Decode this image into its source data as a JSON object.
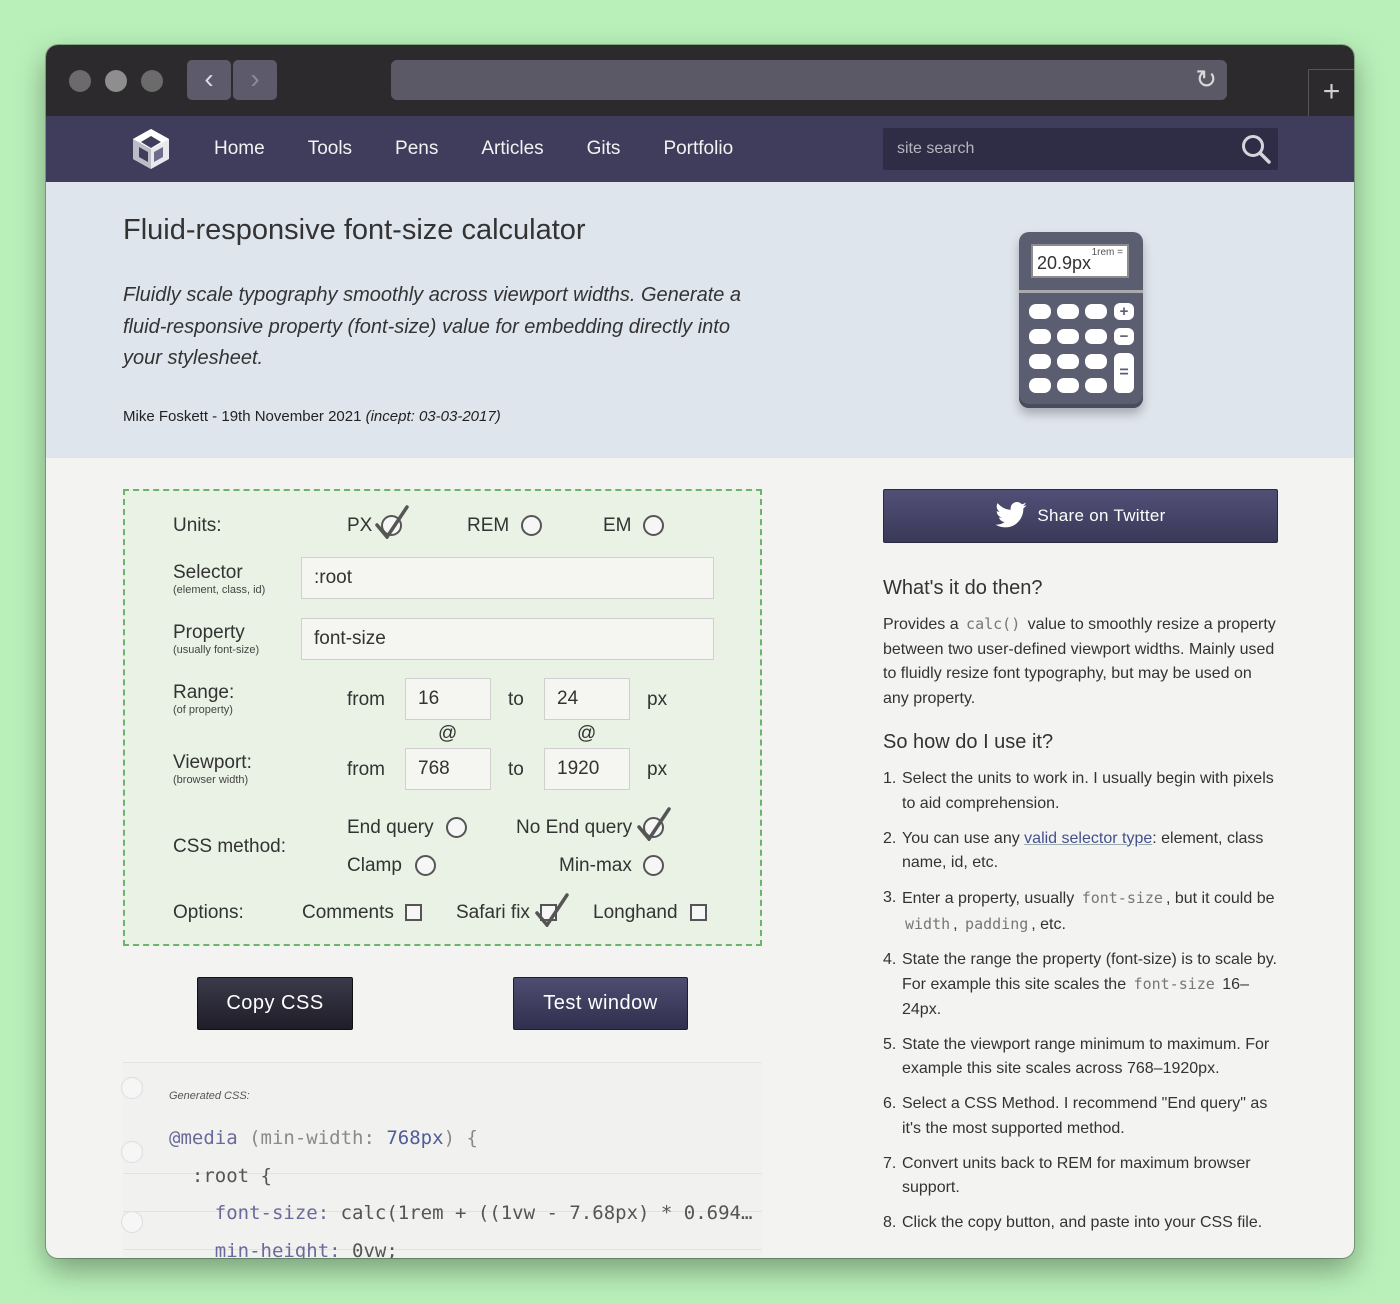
{
  "browser": {
    "back_glyph": "‹",
    "forward_glyph": "›",
    "reload_glyph": "↻",
    "new_tab_glyph": "+"
  },
  "nav": {
    "items": [
      "Home",
      "Tools",
      "Pens",
      "Articles",
      "Gits",
      "Portfolio"
    ],
    "search_placeholder": "site search",
    "bg_color": "#3f3d5b"
  },
  "hero": {
    "title": "Fluid-responsive font-size calculator",
    "lead": "Fluidly scale typography smoothly across viewport widths. Generate a fluid-responsive property (font-size) value for embedding directly into your stylesheet.",
    "byline": "Mike Foskett - 19th November 2021 ",
    "incept": "(incept: 03-03-2017)",
    "calc_display": "20.9px",
    "calc_rem": "1rem =",
    "calc_plus": "+",
    "calc_minus": "−",
    "calc_equals": "="
  },
  "form": {
    "units_label": "Units:",
    "units": {
      "px": "PX",
      "rem": "REM",
      "em": "EM",
      "selected": "PX"
    },
    "selector_label": "Selector",
    "selector_hint": "(element, class, id)",
    "selector_value": ":root",
    "property_label": "Property",
    "property_hint": "(usually font-size)",
    "property_value": "font-size",
    "range_label": "Range:",
    "range_hint": "(of property)",
    "range_from": "16",
    "range_to": "24",
    "viewport_label": "Viewport:",
    "viewport_hint": "(browser width)",
    "viewport_from": "768",
    "viewport_to": "1920",
    "from_text": "from",
    "to_text": "to",
    "px_text": "px",
    "at_text": "@",
    "method_label": "CSS method:",
    "methods": {
      "end_query": "End query",
      "no_end_query": "No End query",
      "clamp": "Clamp",
      "min_max": "Min-max",
      "selected": "No End query"
    },
    "options_label": "Options:",
    "options": {
      "comments": "Comments",
      "safari_fix": "Safari fix",
      "longhand": "Longhand",
      "checked": [
        "Safari fix"
      ]
    }
  },
  "buttons": {
    "copy": "Copy CSS",
    "test": "Test window"
  },
  "code": {
    "caption": "Generated CSS:",
    "line1_at": "@media",
    "line1_rest": " (min-width: ",
    "line1_val": "768px",
    "line1_end": ") {",
    "line2": "  :root {",
    "line3_prop": "    font-size: ",
    "line3_val": "calc(1rem + ((1vw - 7.68px) * 0.694…",
    "line4_prop": "    min-height: ",
    "line4_val": "0vw;"
  },
  "sidebar": {
    "tweet": "Share on Twitter",
    "h_what": "What's it do then?",
    "what_1": "Provides a ",
    "what_code": "calc()",
    "what_2": " value to smoothly resize a property between two user-defined viewport widths. Mainly used to fluidly resize font typography, but may be used on any property.",
    "h_how": "So how do I use it?",
    "steps": {
      "s1": "Select the units to work in. I usually begin with pixels to aid comprehension.",
      "s2a": "You can use any ",
      "s2link": "valid selector type",
      "s2b": ": element, class name, id, etc.",
      "s3a": "Enter a property, usually ",
      "s3c1": "font-size",
      "s3b": ", but it could be ",
      "s3c2": "width",
      "s3d": ", ",
      "s3c3": "padding",
      "s3e": ", etc.",
      "s4a": "State the range the property (font-size) is to scale by. For example this site scales the ",
      "s4c": "font-size",
      "s4b": " 16–24px.",
      "s5": "State the viewport range minimum to maximum. For example this site scales across 768–1920px.",
      "s6": "Select a CSS Method. I recommend \"End query\" as it's the most supported method.",
      "s7": "Convert units back to REM for maximum browser support.",
      "s8": "Click the copy button, and paste into your CSS file."
    }
  }
}
